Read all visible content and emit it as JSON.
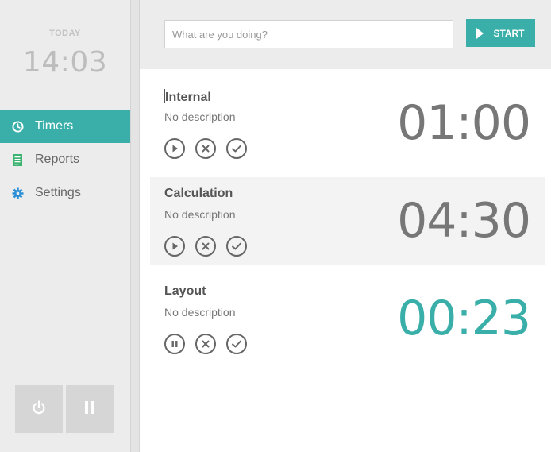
{
  "sidebar": {
    "clock_label": "TODAY",
    "clock_time": "14:03",
    "items": [
      {
        "label": "Timers",
        "icon": "clock-icon",
        "active": true
      },
      {
        "label": "Reports",
        "icon": "document-icon",
        "active": false
      },
      {
        "label": "Settings",
        "icon": "gear-icon",
        "active": false
      }
    ],
    "buttons": [
      {
        "icon": "power-icon"
      },
      {
        "icon": "pause-icon"
      }
    ]
  },
  "header": {
    "search_placeholder": "What are you doing?",
    "search_value": "",
    "start_label": "START"
  },
  "timers": [
    {
      "title": "Internal",
      "description": "No description",
      "time": "01:00",
      "state": "stopped"
    },
    {
      "title": "Calculation",
      "description": "No description",
      "time": "04:30",
      "state": "stopped"
    },
    {
      "title": "Layout",
      "description": "No description",
      "time": "00:23",
      "state": "running"
    }
  ],
  "colors": {
    "accent": "#3aafa9",
    "sidebar_bg": "#ececec",
    "text": "#555555"
  }
}
